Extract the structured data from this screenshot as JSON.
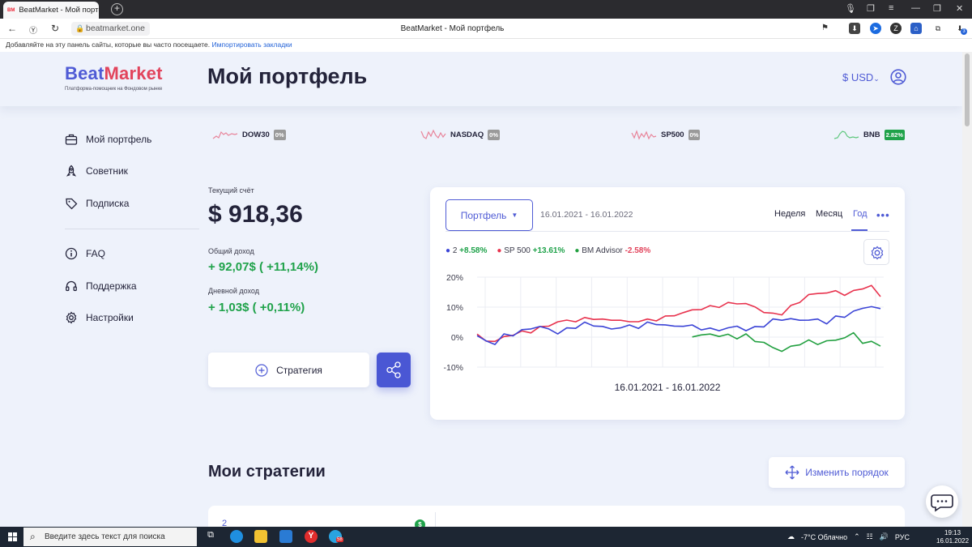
{
  "browser": {
    "tab_title": "BeatMarket - Мой портф",
    "favicon_text": "BM",
    "url": "beatmarket.one",
    "page_title": "BeatMarket - Мой портфель",
    "bookmarks_text": "Добавляйте на эту панель сайты, которые вы часто посещаете.",
    "bookmarks_link": "Импортировать закладки",
    "ext_badge": "3"
  },
  "header": {
    "brand_part1": "Beat",
    "brand_part2": "Market",
    "tagline": "Платформа-помощник на Фондовом рынке",
    "title": "Мой портфель",
    "currency": "$ USD"
  },
  "sidebar": {
    "items": [
      {
        "label": "Мой портфель",
        "icon": "briefcase-icon"
      },
      {
        "label": "Советник",
        "icon": "rocket-icon"
      },
      {
        "label": "Подписка",
        "icon": "tag-icon"
      },
      {
        "label": "FAQ",
        "icon": "info-icon"
      },
      {
        "label": "Поддержка",
        "icon": "headset-icon"
      },
      {
        "label": "Настройки",
        "icon": "gear-icon"
      }
    ]
  },
  "tickers": [
    {
      "name": "DOW30",
      "change": "0%",
      "color": "#e2445c",
      "badge": "#9a9a9a"
    },
    {
      "name": "NASDAQ",
      "change": "0%",
      "color": "#e2445c",
      "badge": "#9a9a9a"
    },
    {
      "name": "SP500",
      "change": "0%",
      "color": "#e2445c",
      "badge": "#9a9a9a"
    },
    {
      "name": "BNB",
      "change": "2.82%",
      "color": "#1fa24a",
      "badge": "#1fa24a"
    }
  ],
  "account": {
    "balance_label": "Текущий счёт",
    "balance": "$ 918,36",
    "total_label": "Общий доход",
    "total_value": "+ 92,07$ ( +11,14%)",
    "daily_label": "Дневной доход",
    "daily_value": "+ 1,03$ ( +0,11%)",
    "strategy_button": "Стратегия"
  },
  "chart_card": {
    "select_label": "Портфель",
    "date_range": "16.01.2021 - 16.01.2022",
    "periods": [
      "Неделя",
      "Месяц",
      "Год"
    ],
    "selected_period": "Год",
    "more": "•••"
  },
  "chart_data": {
    "type": "line",
    "x_range": [
      "16.01.2021",
      "16.01.2022"
    ],
    "xlabel": "16.01.2021 - 16.01.2022",
    "ylabel": "",
    "yticks": [
      "20%",
      "10%",
      "0%",
      "-10%"
    ],
    "ylim": [
      -10,
      20
    ],
    "grid": true,
    "legend_position": "top-left",
    "series": [
      {
        "name": "2",
        "change": "+8.58%",
        "color": "#3b44d6",
        "values": [
          0.5,
          -1.5,
          -2,
          0.5,
          1,
          2,
          3,
          3.5,
          2.5,
          1.5,
          2.5,
          3.5,
          4.5,
          4,
          3.5,
          2.5,
          3.5,
          3.5,
          3.5,
          4.5,
          4.5,
          4,
          3.5,
          4,
          3.5,
          3,
          2.5,
          2.5,
          3,
          3.5,
          2.5,
          3,
          4,
          5.5,
          6,
          6,
          5.5,
          6,
          5.5,
          5,
          6.5,
          7,
          8.5,
          9.5,
          10.5,
          9
        ]
      },
      {
        "name": "SP 500",
        "change": "+13.61%",
        "color": "#e8334e",
        "values": [
          0.5,
          -1,
          -1.5,
          0,
          1,
          1.5,
          2,
          3,
          4,
          5,
          5.5,
          5.5,
          6,
          6.5,
          5.5,
          6,
          5.5,
          5,
          5.5,
          5.5,
          6,
          6.5,
          7.5,
          8,
          9,
          9.5,
          10,
          10.5,
          11,
          11.5,
          11,
          10,
          8.5,
          7.5,
          8,
          10,
          12,
          14,
          14.5,
          15,
          15,
          14.5,
          15,
          16.5,
          17,
          13.5
        ]
      },
      {
        "name": "BM Advisor",
        "change": "-2.58%",
        "color": "#22a040",
        "start_index": 24,
        "values": [
          0.5,
          0.5,
          1,
          0.5,
          0.5,
          0,
          0.5,
          -1,
          -2,
          -3.5,
          -4.5,
          -3.5,
          -2,
          -1.5,
          -2,
          -1.5,
          -1,
          0,
          1,
          -1.5,
          -2,
          -2.5
        ]
      }
    ]
  },
  "strategies": {
    "title": "Мои стратегии",
    "reorder_button": "Изменить порядок",
    "first_number": "2",
    "first_badge": "$"
  },
  "taskbar": {
    "search_placeholder": "Введите здесь текст для поиска",
    "weather": "-7°C  Облачно",
    "language": "РУС",
    "time": "19:13",
    "date": "16.01.2022",
    "telegram_badge": "58"
  }
}
